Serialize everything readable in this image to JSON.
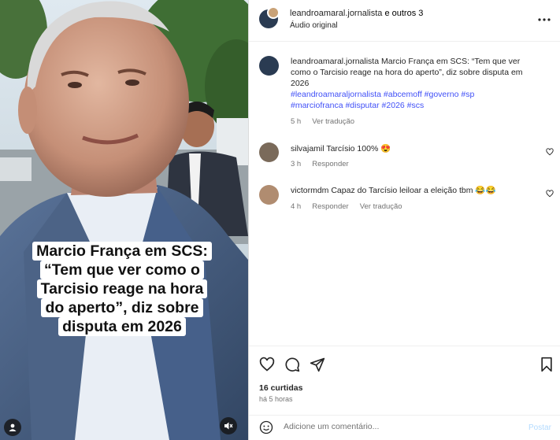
{
  "media": {
    "caption_lines": [
      "Marcio França em SCS:",
      "“Tem que ver como o",
      "Tarcisio reage na hora",
      "do aperto”, diz sobre",
      "disputa em 2026"
    ],
    "icons": {
      "user": "user-icon",
      "mute": "speaker-muted-icon"
    }
  },
  "header": {
    "author": "leandroamaral.jornalista",
    "joiner": " e ",
    "others": "outros 3",
    "audio": "Áudio original",
    "more_icon": "more-options-icon"
  },
  "post_caption": {
    "author": "leandroamaral.jornalista",
    "text": "Marcio França em SCS: “Tem que ver como o Tarcisio reage na hora do aperto”, diz sobre disputa em 2026",
    "hashtags": "#leandroamaraljornalista #abcemoff #governo #sp #marciofranca #disputar #2026 #scs",
    "time": "5 h",
    "translate": "Ver tradução"
  },
  "comments": [
    {
      "user": "silvajamil",
      "text": "Tarcísio 100% 😍",
      "time": "3 h",
      "reply": "Responder",
      "translate": ""
    },
    {
      "user": "victormdm",
      "text": "Capaz do Tarcísio leiloar a eleição tbm 😂😂",
      "time": "4 h",
      "reply": "Responder",
      "translate": "Ver tradução"
    }
  ],
  "actions": {
    "likes": "16 curtidas",
    "time": "há 5 horas",
    "icons": [
      "heart-icon",
      "comment-icon",
      "share-icon",
      "bookmark-icon"
    ]
  },
  "composer": {
    "placeholder": "Adicione um comentário...",
    "post_label": "Postar"
  },
  "colors": {
    "link": "#4150f7",
    "muted_text": "#737373",
    "post_disabled": "#b3dbff"
  }
}
